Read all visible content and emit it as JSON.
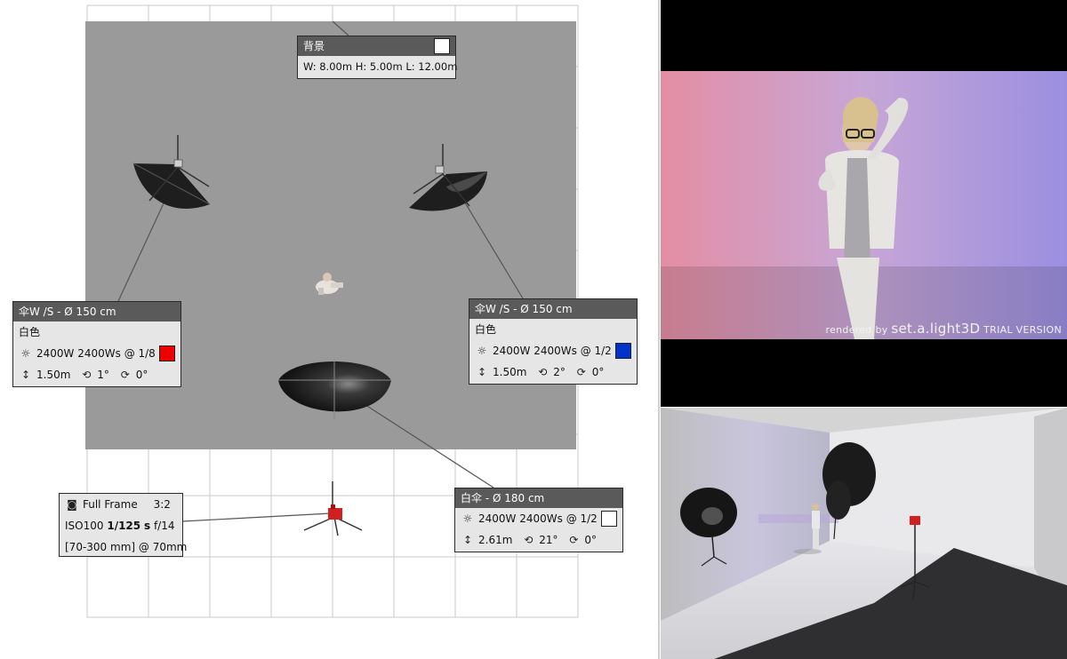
{
  "floor_plan": {
    "background_box": {
      "title": "背景",
      "dimensions": "W: 8.00m  H: 5.00m  L: 12.00m",
      "swatch_color": "#ffffff"
    },
    "light_left": {
      "title": "伞W /S - Ø 150 cm",
      "color_name": "白色",
      "power": "2400W 2400Ws @ 1/8",
      "swatch_color": "#ee0000",
      "height": "1.50m",
      "tilt": "1°",
      "rotation": "0°",
      "icons": [
        "sun-icon",
        "height-icon",
        "tilt-icon",
        "rotation-icon"
      ]
    },
    "light_right": {
      "title": "伞W /S - Ø 150 cm",
      "color_name": "白色",
      "power": "2400W 2400Ws @ 1/2",
      "swatch_color": "#0033cc",
      "height": "1.50m",
      "tilt": "2°",
      "rotation": "0°"
    },
    "light_bottom": {
      "title": "白伞 - Ø 180 cm",
      "power": "2400W 2400Ws @ 1/2",
      "swatch_color": "#ffffff",
      "height": "2.61m",
      "tilt": "21°",
      "rotation": "0°"
    },
    "camera": {
      "icon": "camera-icon",
      "sensor": "Full Frame",
      "aspect": "3:2",
      "iso": "ISO100",
      "shutter": "1/125",
      "shutter_unit": "s",
      "aperture": "f/14",
      "lens": "[70-300 mm] @ 70mm"
    }
  },
  "render_view": {
    "watermark_prefix": "rendered by",
    "watermark_brand": "set.a.light",
    "watermark_brand_suffix": "3D",
    "watermark_trial": "TRIAL VERSION"
  },
  "colors": {
    "grid_line": "#c8c8c8",
    "backdrop": "#9a9a9a",
    "header": "#5a5a5a",
    "panel": "#e6e6e6",
    "leader": "#555555"
  }
}
